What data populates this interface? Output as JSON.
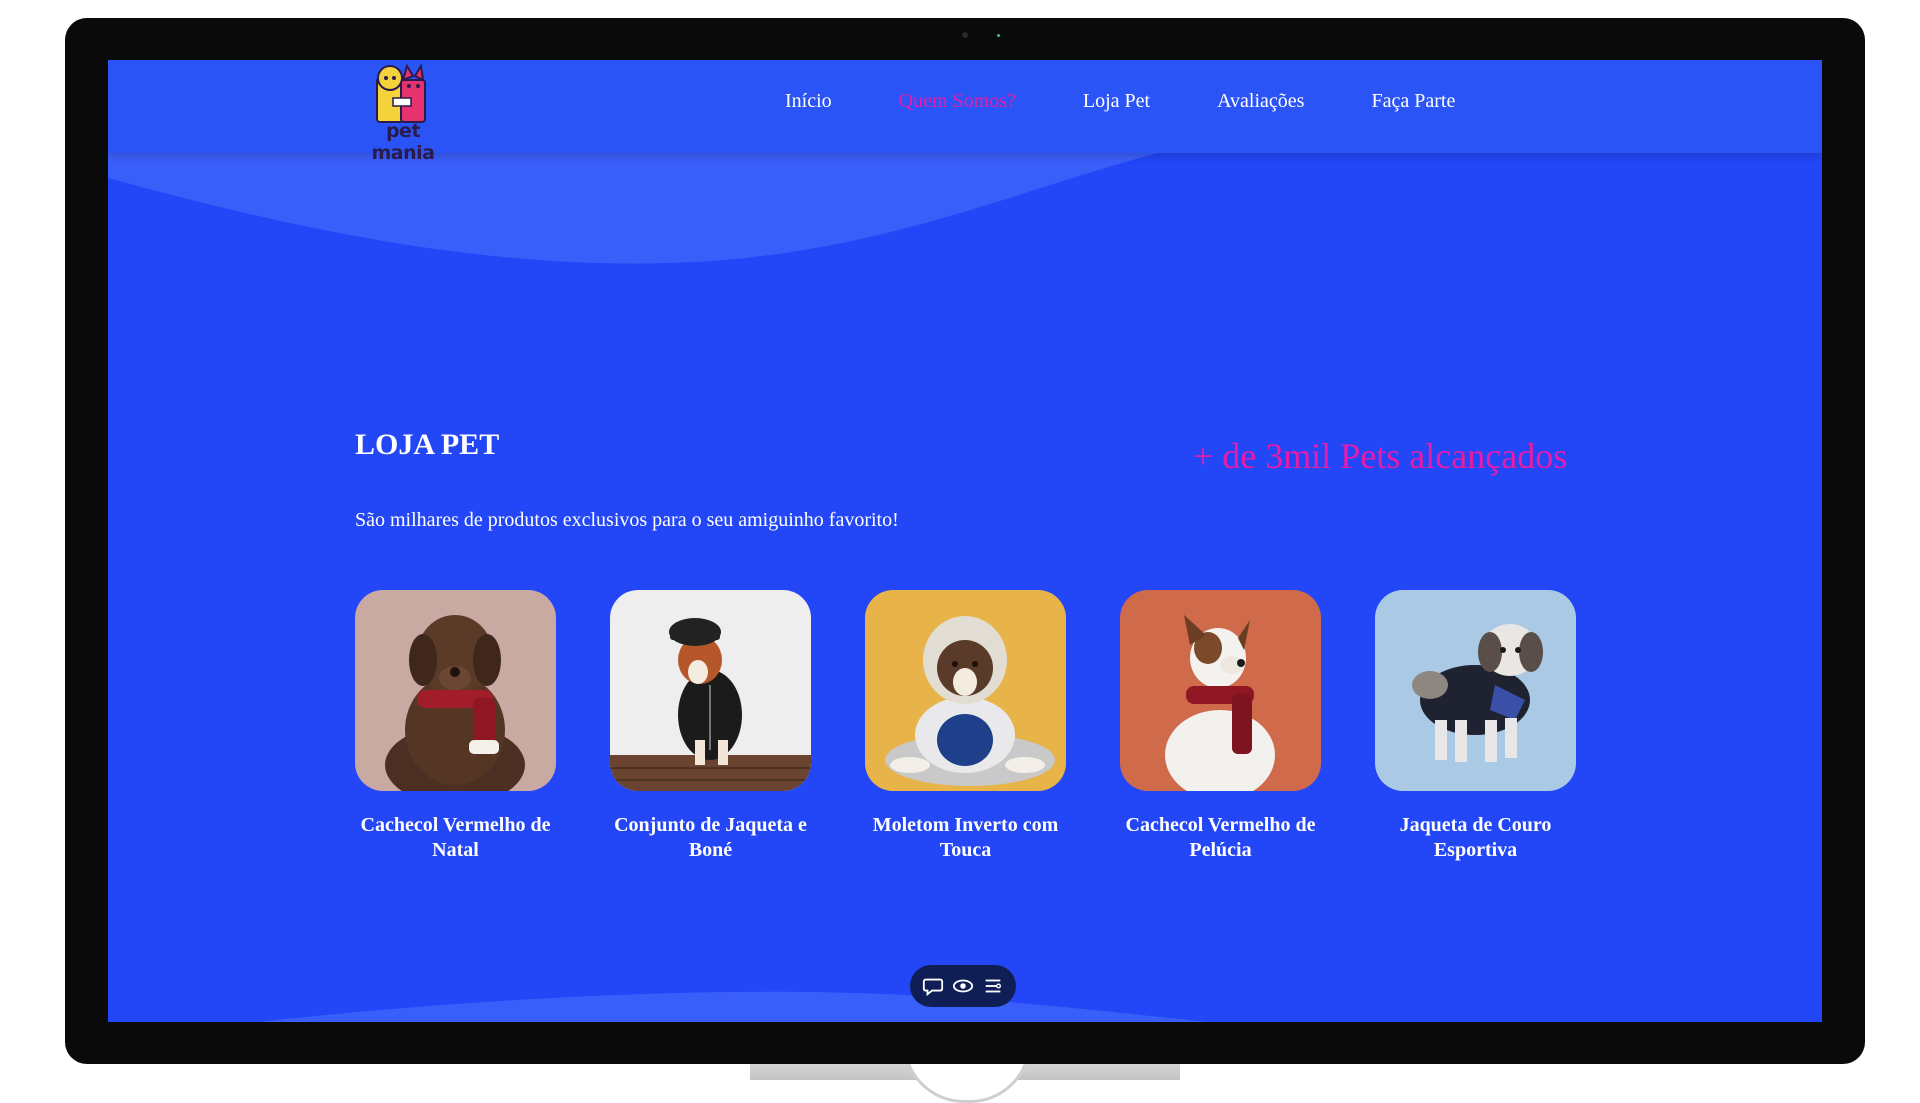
{
  "brand": {
    "logo_text": "pet mania"
  },
  "nav": {
    "items": [
      {
        "label": "Início",
        "active": false
      },
      {
        "label": "Quem Somos?",
        "active": true
      },
      {
        "label": "Loja Pet",
        "active": false
      },
      {
        "label": "Avaliações",
        "active": false
      },
      {
        "label": "Faça Parte",
        "active": false
      }
    ]
  },
  "section": {
    "title": "LOJA PET",
    "stat": "+ de 3mil Pets alcançados",
    "subtitle": "São milhares de produtos exclusivos para o seu amiguinho favorito!"
  },
  "products": [
    {
      "name": "Cachecol Vermelho de Natal",
      "bg": "#c9aaa3",
      "dog": "chocolate-labrador-icon"
    },
    {
      "name": "Conjunto de Jaqueta e Boné",
      "bg": "#eeeeee",
      "dog": "basenji-icon"
    },
    {
      "name": "Moletom Inverto com Touca",
      "bg": "#e8b44a",
      "dog": "australian-shepherd-icon"
    },
    {
      "name": "Cachecol Vermelho de Pelúcia",
      "bg": "#cf6a4a",
      "dog": "jack-russell-icon"
    },
    {
      "name": "Jaqueta de Couro Esportiva",
      "bg": "#a9c9e4",
      "dog": "shih-tzu-icon"
    }
  ],
  "widget": {
    "icons": [
      "chat-icon",
      "eye-icon",
      "menu-icon"
    ]
  },
  "colors": {
    "background": "#2346f7",
    "header": "#2a54f6",
    "accent": "#e81ca8",
    "text": "#ffffff",
    "widget": "#0f1f55"
  }
}
